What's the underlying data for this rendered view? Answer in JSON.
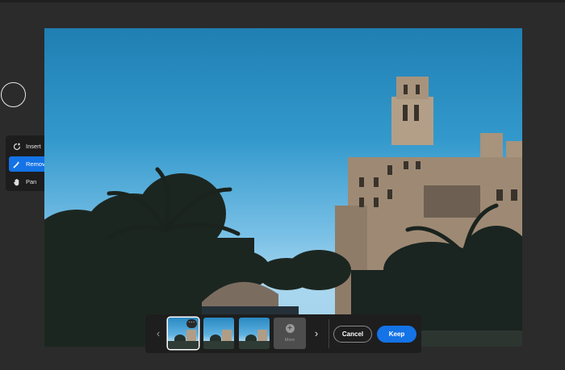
{
  "tools": [
    {
      "label": "Insert",
      "icon": "insert-icon",
      "active": false
    },
    {
      "label": "Remove",
      "icon": "remove-icon",
      "active": true
    },
    {
      "label": "Pan",
      "icon": "hand-icon",
      "active": false
    }
  ],
  "filmstrip": {
    "prev": "‹",
    "next": "›",
    "more_dots": "···",
    "more_label": "More",
    "more_plus": "+",
    "cancel_label": "Cancel",
    "keep_label": "Keep"
  },
  "colors": {
    "accent": "#1473e6",
    "background": "#2b2b2b",
    "panel": "#1e1e1e"
  }
}
